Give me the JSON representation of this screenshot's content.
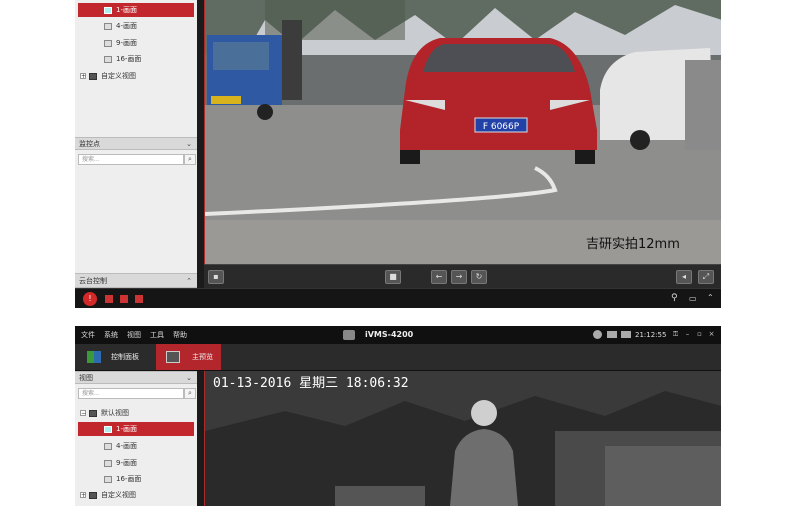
{
  "colors": {
    "accent": "#c1272d",
    "toolbar": "#2a2a2a",
    "panel": "#eeeeee"
  },
  "top": {
    "tree": [
      {
        "label": "1-画面",
        "selected": true
      },
      {
        "label": "4-画面"
      },
      {
        "label": "9-画面"
      },
      {
        "label": "16-画面"
      },
      {
        "label": "自定义视图"
      }
    ],
    "monitor_section": "监控点",
    "search_placeholder": "搜索...",
    "ptz_section": "云台控制",
    "plate": "F 6066P",
    "watermark": "吉研实拍12mm"
  },
  "bottom": {
    "menu": [
      "文件",
      "系统",
      "视图",
      "工具",
      "帮助"
    ],
    "app_title": "iVMS-4200",
    "clock": "21:12:55",
    "tabs": [
      {
        "label": "控制面板"
      },
      {
        "label": "主预览"
      }
    ],
    "view_section": "视图",
    "search_placeholder": "搜索...",
    "tree": [
      {
        "label": "默认视图"
      },
      {
        "label": "1-画面",
        "selected": true
      },
      {
        "label": "4-画面"
      },
      {
        "label": "9-画面"
      },
      {
        "label": "16-画面"
      },
      {
        "label": "自定义视图"
      }
    ],
    "osd": "01-13-2016 星期三 18:06:32"
  }
}
